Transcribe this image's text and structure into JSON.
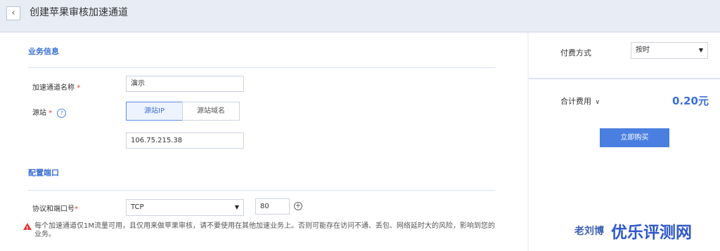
{
  "header": {
    "back_icon": "‹",
    "title": "创建苹果审核加速通道"
  },
  "business": {
    "section_title": "业务信息",
    "channel_name_label": "加速通道名称",
    "channel_name_value": "演示",
    "source_label": "源站",
    "required_mark": "*",
    "help_icon": "?",
    "source_tabs": [
      "源站IP",
      "源站域名"
    ],
    "source_ip_value": "106.75.215.38"
  },
  "ports": {
    "section_title": "配置端口",
    "protocol_label": "协议和端口号",
    "protocol_value": "TCP",
    "port_value": "80",
    "add_icon": "+"
  },
  "warning": {
    "icon": "!",
    "text": "每个加速通道仅1M流量可用，且仅用来做苹果审核，请不要使用在其他加速业务上。否则可能存在访问不通、丢包、网络延时大的风险，影响到您的业务。"
  },
  "side": {
    "pay_label": "付费方式",
    "pay_value": "按时",
    "total_label": "合计费用",
    "total_chevron": "∨",
    "total_price": "0.20元",
    "buy_label": "立即购买"
  },
  "watermark": {
    "small": "老刘博",
    "big": "优乐评测网"
  },
  "colors": {
    "accent": "#3a6fd8",
    "button": "#4a7fe0",
    "danger": "#e53935"
  }
}
